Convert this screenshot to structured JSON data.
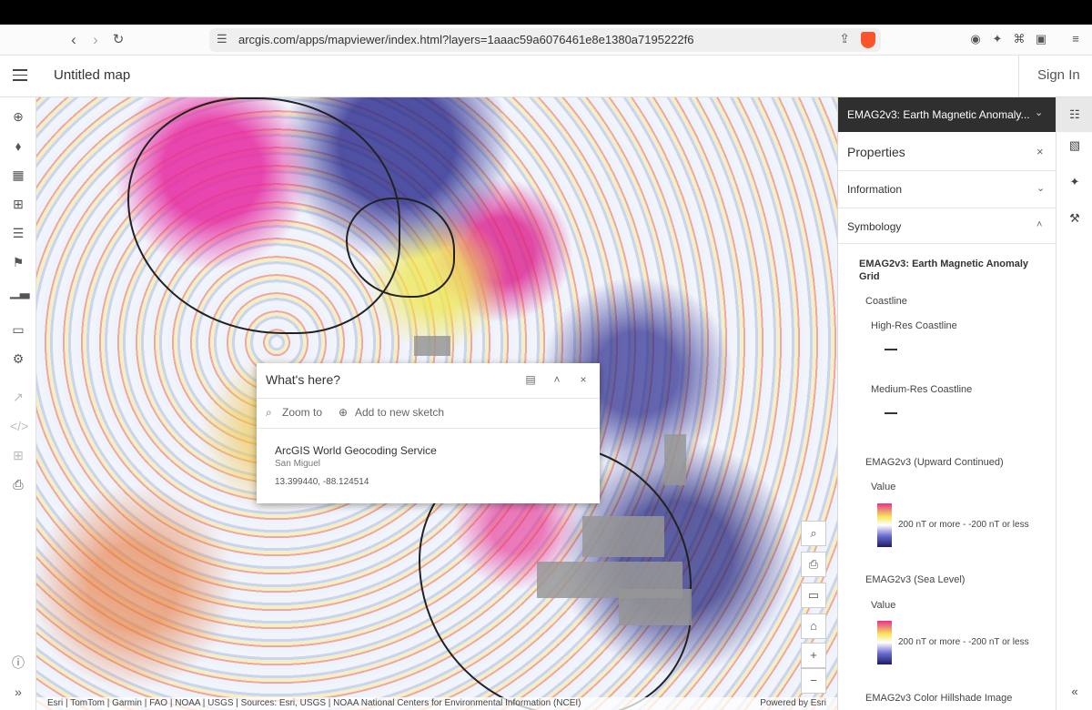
{
  "browser": {
    "url": "arcgis.com/apps/mapviewer/index.html?layers=1aaac59a6076461e8e1380a7195222f6"
  },
  "header": {
    "title": "Untitled map",
    "sign_in": "Sign In"
  },
  "map": {
    "attribution": "Esri | TomTom | Garmin | FAO | NOAA | USGS | Sources: Esri, USGS | NOAA National Centers for Environmental Information (NCEI)",
    "powered_by": "Powered by Esri"
  },
  "popup": {
    "title": "What's here?",
    "zoom_to": "Zoom to",
    "add_to_sketch": "Add to new sketch",
    "service": "ArcGIS World Geocoding Service",
    "place": "San Miguel",
    "coords": "13.399440, -88.124514"
  },
  "panel": {
    "layer_title": "EMAG2v3: Earth Magnetic Anomaly...",
    "properties": "Properties",
    "sections": {
      "information": "Information",
      "symbology": "Symbology"
    },
    "legend": {
      "layer_name": "EMAG2v3: Earth Magnetic Anomaly Grid",
      "coastline": "Coastline",
      "high_res": "High-Res Coastline",
      "medium_res": "Medium-Res Coastline",
      "upward": "EMAG2v3 (Upward Continued)",
      "value1": "Value",
      "range1": "200 nT or more - -200 nT or less",
      "sea_level": "EMAG2v3 (Sea Level)",
      "value2": "Value",
      "range2": "200 nT or more - -200 nT or less",
      "hillshade": "EMAG2v3 Color Hillshade Image"
    }
  },
  "icons": {
    "left": [
      "add-icon",
      "layers-icon",
      "table-icon",
      "basemap-icon",
      "legend-icon",
      "bookmark-icon",
      "chart-icon",
      "save-icon",
      "settings-icon"
    ],
    "right": [
      "properties-icon",
      "styles-icon",
      "effects-icon",
      "configure-icon"
    ]
  }
}
